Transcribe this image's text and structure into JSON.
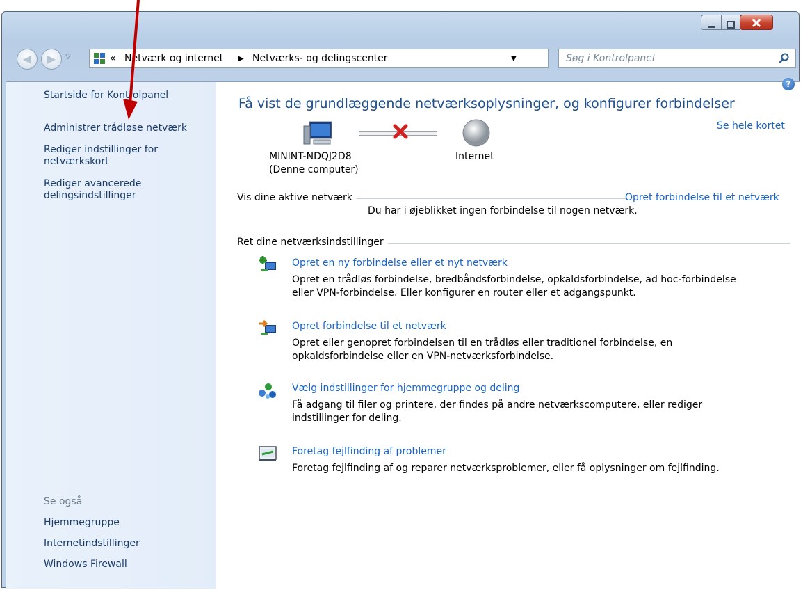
{
  "breadcrumb": {
    "separator": "«",
    "items": [
      "Netværk og internet",
      "Netværks- og delingscenter"
    ]
  },
  "search": {
    "placeholder": "Søg i Kontrolpanel"
  },
  "sidebar": {
    "items": [
      {
        "label": "Startside for Kontrolpanel"
      },
      {
        "label": "Administrer trådløse netværk"
      },
      {
        "label": "Rediger indstillinger for netværkskort"
      },
      {
        "label": "Rediger avancerede delingsindstillinger"
      }
    ],
    "see_also_heading": "Se også",
    "see_also": [
      "Hjemmegruppe",
      "Internetindstillinger",
      "Windows Firewall"
    ]
  },
  "main": {
    "title": "Få vist de grundlæggende netværksoplysninger, og konfigurer forbindelser",
    "map": {
      "computer_name": "MININT-NDQJ2D8",
      "computer_sub": "(Denne computer)",
      "internet_label": "Internet",
      "full_map_link": "Se hele kortet"
    },
    "active_networks": {
      "heading": "Vis dine aktive netværk",
      "connect_link": "Opret forbindelse til et netværk",
      "status": "Du har i øjeblikket ingen forbindelse til nogen netværk."
    },
    "settings": {
      "heading": "Ret dine netværksindstillinger",
      "tasks": [
        {
          "title": "Opret en ny forbindelse eller et nyt netværk",
          "line1": "Opret en trådløs forbindelse, bredbåndsforbindelse, opkaldsforbindelse, ad hoc-forbindelse",
          "line2": "eller VPN-forbindelse. Eller konfigurer en router eller et adgangspunkt."
        },
        {
          "title": "Opret forbindelse til et netværk",
          "line1": "Opret eller genopret forbindelsen til en trådløs eller traditionel forbindelse, en",
          "line2": "opkaldsforbindelse eller en VPN-netværksforbindelse."
        },
        {
          "title": "Vælg indstillinger for hjemmegruppe og deling",
          "line1": "Få adgang til filer og printere, der findes på andre netværkscomputere, eller rediger",
          "line2": "indstillinger for deling."
        },
        {
          "title": "Foretag fejlfinding af problemer",
          "line1": "Foretag fejlfinding af og reparer netværksproblemer, eller få oplysninger om fejlfinding.",
          "line2": ""
        }
      ]
    }
  },
  "colors": {
    "link": "#1a64c4",
    "annotation_arrow": "#c00000",
    "sidebar_bg": "#e6eff9"
  }
}
